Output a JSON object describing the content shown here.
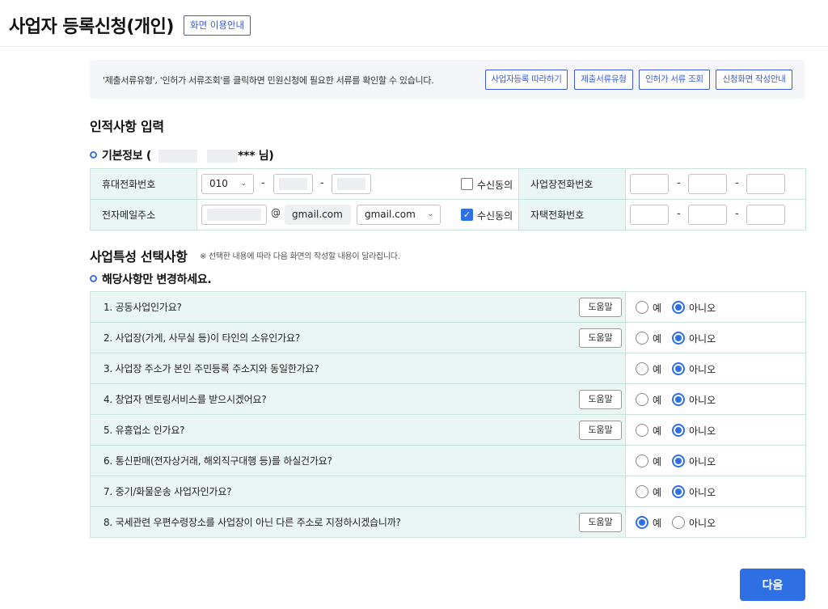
{
  "header": {
    "title": "사업자 등록신청(개인)",
    "guide_label": "화면 이용안내"
  },
  "info": {
    "text": "'제출서류유형', '인허가 서류조회'를 클릭하면 민원신청에 필요한 서류를 확인할 수 있습니다.",
    "buttons": [
      "사업자등록 따라하기",
      "제출서류유형",
      "인허가 서류 조회",
      "신청화면 작성안내"
    ]
  },
  "personal": {
    "section_title": "인적사항 입력",
    "basic_label": "기본정보 (",
    "name_suffix": "*** 님)",
    "mobile_label": "휴대전화번호",
    "mobile_prefix": "010",
    "dash": "-",
    "consent_label": "수신동의",
    "biz_phone_label": "사업장전화번호",
    "email_label": "전자메일주소",
    "at": "@",
    "email_domain": "gmail.com",
    "email_domain_select": "gmail.com",
    "home_phone_label": "자택전화번호",
    "mobile_consent": false,
    "email_consent": true
  },
  "business": {
    "section_title": "사업특성 선택사항",
    "note": "※ 선택한 내용에 따라 다음 화면의 작성할 내용이 달라집니다.",
    "sub_title": "해당사항만 변경하세요.",
    "help_label": "도움말",
    "yes_label": "예",
    "no_label": "아니오",
    "questions": [
      {
        "text": "1. 공동사업인가요?",
        "help": true,
        "answer": "no"
      },
      {
        "text": "2. 사업장(가게, 사무실 등)이 타인의 소유인가요?",
        "help": true,
        "answer": "no"
      },
      {
        "text": "3. 사업장 주소가 본인 주민등록 주소지와 동일한가요?",
        "help": false,
        "answer": "no"
      },
      {
        "text": "4. 창업자 멘토링서비스를 받으시겠어요?",
        "help": true,
        "answer": "no"
      },
      {
        "text": "5. 유흥업소 인가요?",
        "help": true,
        "answer": "no"
      },
      {
        "text": "6. 통신판매(전자상거래, 해외직구대행 등)를 하실건가요?",
        "help": false,
        "answer": "no"
      },
      {
        "text": "7. 중기/화물운송 사업자인가요?",
        "help": false,
        "answer": "no"
      },
      {
        "text": "8. 국세관련 우편수령장소를 사업장이 아닌 다른 주소로 지정하시겠습니까?",
        "help": true,
        "answer": "yes"
      }
    ]
  },
  "footer": {
    "next_label": "다음"
  },
  "colors": {
    "accent": "#2f6fe4",
    "label_bg": "#eaf6f3",
    "border": "#c9e3dd"
  }
}
